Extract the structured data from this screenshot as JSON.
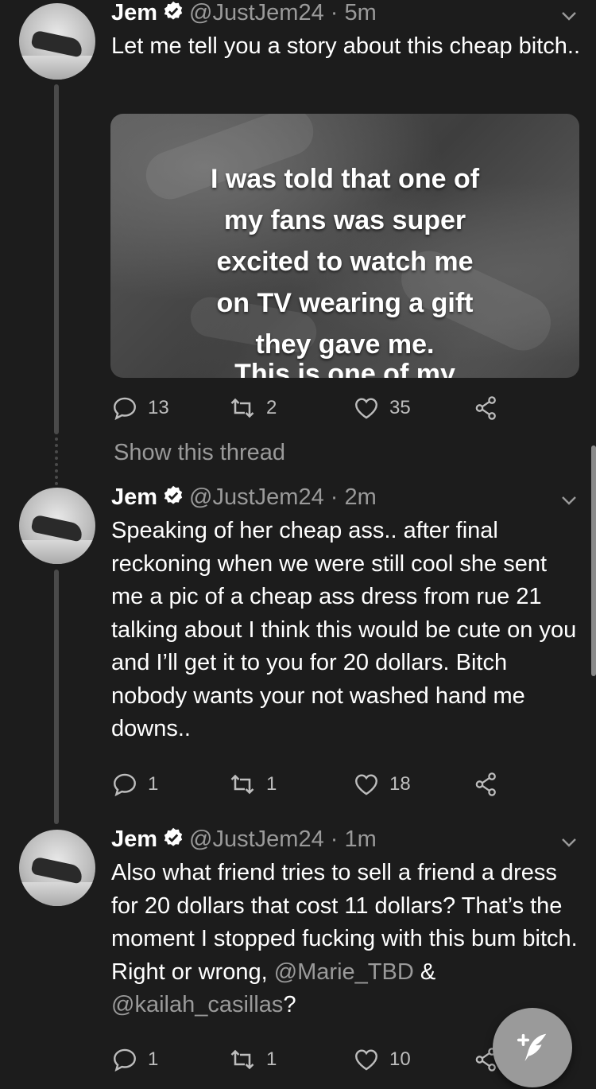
{
  "colors": {
    "background": "#1c1c1c",
    "text": "#ffffff",
    "muted": "#9a9a9a",
    "icon": "#bdbdbd"
  },
  "tweets": [
    {
      "name": "Jem",
      "handle": "@JustJem24",
      "sep": "·",
      "time": "5m",
      "text": "Let me tell you a story about this cheap bitch..",
      "media_caption": "I was told that one of my fans was super excited to watch me on TV wearing a gift they gave me.",
      "media_caption_lines": [
        "I was told that one of",
        "my fans was super",
        "excited to watch me",
        "on TV wearing a gift",
        "they gave me."
      ],
      "media_cut_text": "This is one of my",
      "replies": "13",
      "retweets": "2",
      "likes": "35"
    },
    {
      "name": "Jem",
      "handle": "@JustJem24",
      "sep": "·",
      "time": "2m",
      "text": "Speaking of her cheap ass.. after final reckoning when we were still cool she sent me a pic of a cheap ass dress from rue 21 talking about I think this would be cute on you and I’ll get it to you for 20 dollars. Bitch nobody wants your not washed hand me downs..",
      "replies": "1",
      "retweets": "1",
      "likes": "18"
    },
    {
      "name": "Jem",
      "handle": "@JustJem24",
      "sep": "·",
      "time": "1m",
      "text_before": "Also what friend tries to sell a friend a dress for 20 dollars that cost 11 dollars? That’s the moment I stopped fucking with this bum bitch. Right or wrong, ",
      "mention1": "@Marie_TBD",
      "amp": " & ",
      "mention2": "@kailah_casillas",
      "text_after": "?",
      "replies": "1",
      "retweets": "1",
      "likes": "10"
    }
  ],
  "show_thread": "Show this thread",
  "icons": [
    "verified-badge-icon",
    "chevron-down-icon",
    "reply-icon",
    "retweet-icon",
    "like-icon",
    "share-icon",
    "compose-tweet-icon"
  ]
}
